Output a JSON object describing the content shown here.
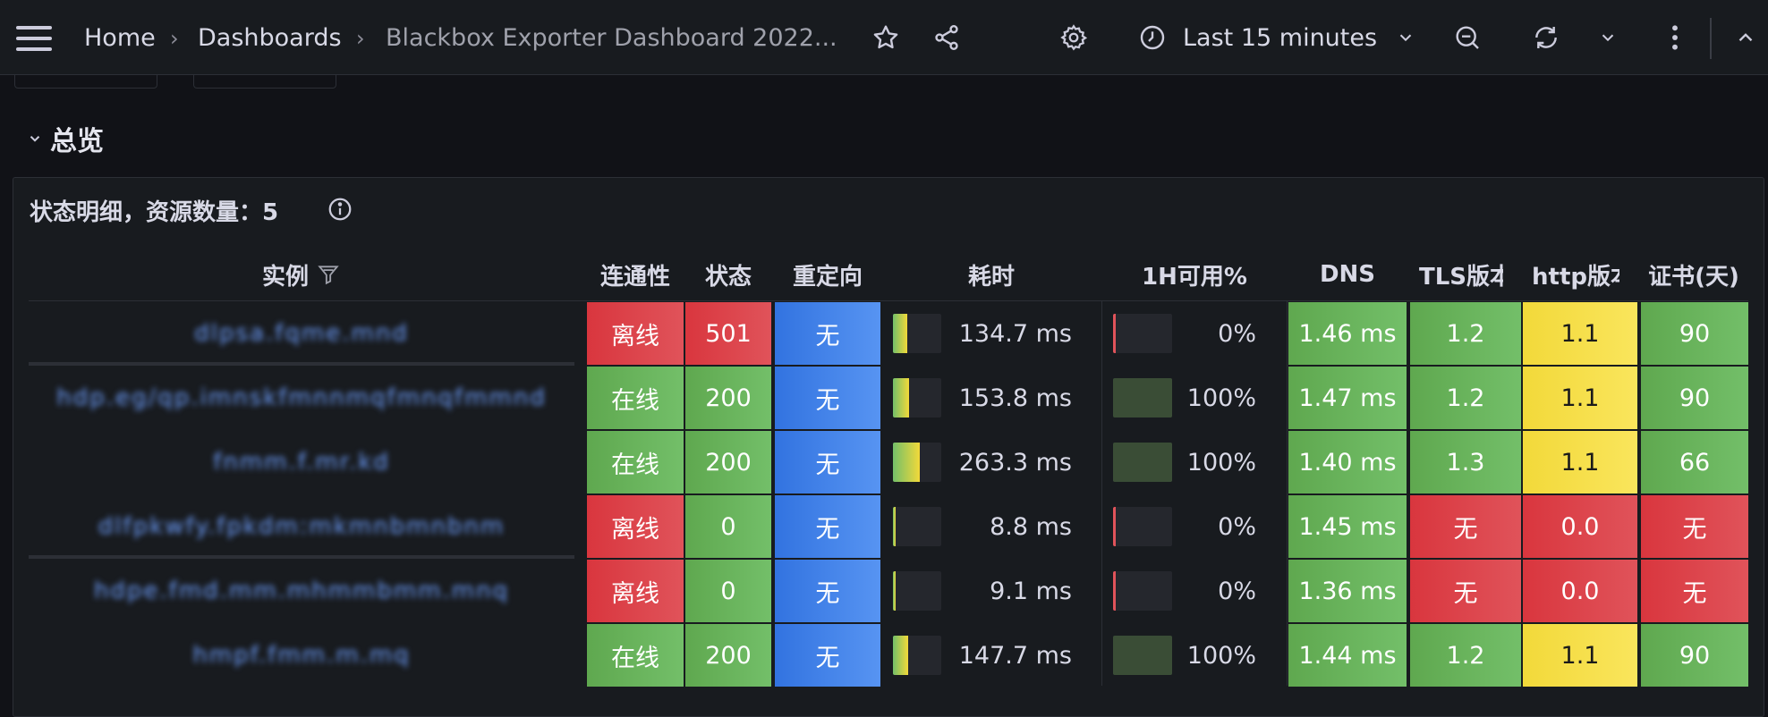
{
  "breadcrumb": {
    "home": "Home",
    "dashboards": "Dashboards",
    "current": "Blackbox Exporter Dashboard 2022...",
    "separator": "›"
  },
  "toolbar": {
    "time_range": "Last 15 minutes",
    "icons": [
      "menu-icon",
      "star-icon",
      "share-icon",
      "gear-icon",
      "clock-icon",
      "zoom-out-icon",
      "refresh-icon",
      "chevron-down-icon",
      "kebab-icon",
      "chevron-up-icon"
    ]
  },
  "row": {
    "title": "总览"
  },
  "panel": {
    "title": "状态明细，资源数量：5",
    "columns": {
      "instance": "实例",
      "connectivity": "连通性",
      "status": "状态",
      "redirect": "重定向",
      "duration": "耗时",
      "availability": "1H可用%",
      "dns": "DNS",
      "tls": "TLS版本",
      "http": "http版本",
      "cert": "证书(天)"
    },
    "rows": [
      {
        "instance": "dlpsa.fqme.mnd",
        "conn": "离线",
        "conn_color": "red",
        "status": "501",
        "status_color": "red",
        "redirect": "无",
        "duration": "134.7 ms",
        "duration_level": 0.3,
        "avail": "0%",
        "avail_level": 0,
        "dns": "1.46 ms",
        "tls": "1.2",
        "tls_color": "green",
        "http": "1.1",
        "http_color": "yellow",
        "cert": "90",
        "cert_color": "green"
      },
      {
        "instance": "hdp.eg/qp.imnskfmnnmqfmnqfmmnd",
        "conn": "在线",
        "conn_color": "green",
        "status": "200",
        "status_color": "green",
        "redirect": "无",
        "duration": "153.8 ms",
        "duration_level": 0.33,
        "avail": "100%",
        "avail_level": 1,
        "dns": "1.47 ms",
        "tls": "1.2",
        "tls_color": "green",
        "http": "1.1",
        "http_color": "yellow",
        "cert": "90",
        "cert_color": "green"
      },
      {
        "instance": "fnmm.f.mr.kd",
        "conn": "在线",
        "conn_color": "green",
        "status": "200",
        "status_color": "green",
        "redirect": "无",
        "duration": "263.3 ms",
        "duration_level": 0.55,
        "avail": "100%",
        "avail_level": 1,
        "dns": "1.40 ms",
        "tls": "1.3",
        "tls_color": "green",
        "http": "1.1",
        "http_color": "yellow",
        "cert": "66",
        "cert_color": "green"
      },
      {
        "instance": "dlfpkwfy.fpkdm:mkmnbmnbnm",
        "conn": "离线",
        "conn_color": "red",
        "status": "0",
        "status_color": "green",
        "redirect": "无",
        "duration": "8.8 ms",
        "duration_level": 0.04,
        "avail": "0%",
        "avail_level": 0,
        "dns": "1.45 ms",
        "tls": "无",
        "tls_color": "red",
        "http": "0.0",
        "http_color": "red",
        "cert": "无",
        "cert_color": "red"
      },
      {
        "instance": "hdpe.fmd.mm.mhmmbmm.mnq",
        "conn": "离线",
        "conn_color": "red",
        "status": "0",
        "status_color": "green",
        "redirect": "无",
        "duration": "9.1 ms",
        "duration_level": 0.04,
        "avail": "0%",
        "avail_level": 0,
        "dns": "1.36 ms",
        "tls": "无",
        "tls_color": "red",
        "http": "0.0",
        "http_color": "red",
        "cert": "无",
        "cert_color": "red"
      },
      {
        "instance": "hmpf.fmm.m.mq",
        "conn": "在线",
        "conn_color": "green",
        "status": "200",
        "status_color": "green",
        "redirect": "无",
        "duration": "147.7 ms",
        "duration_level": 0.32,
        "avail": "100%",
        "avail_level": 1,
        "dns": "1.44 ms",
        "tls": "1.2",
        "tls_color": "green",
        "http": "1.1",
        "http_color": "yellow",
        "cert": "90",
        "cert_color": "green"
      }
    ]
  }
}
